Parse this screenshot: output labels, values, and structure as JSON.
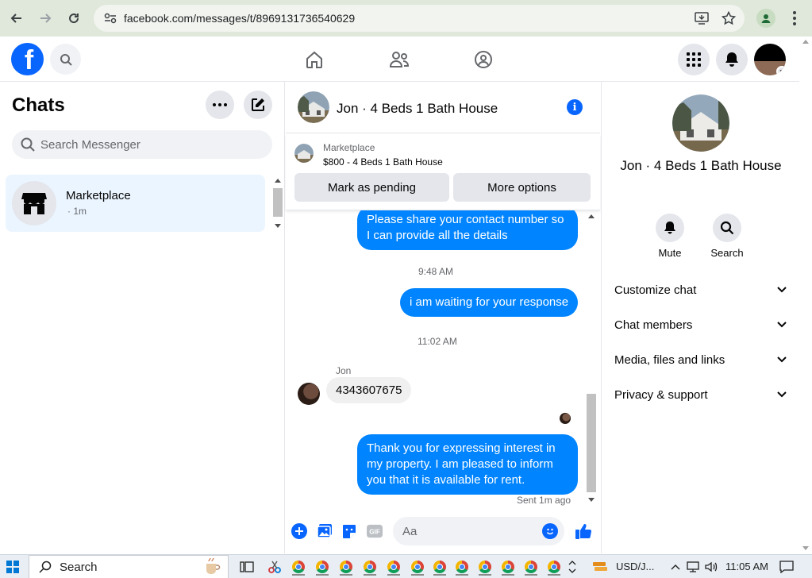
{
  "browser": {
    "url": "facebook.com/messages/t/8969131736540629"
  },
  "chats_panel": {
    "title": "Chats",
    "search_placeholder": "Search Messenger",
    "items": [
      {
        "name": "Marketplace",
        "subtitle": "· 1m"
      }
    ]
  },
  "conversation": {
    "title": "Jon · 4 Beds 1 Bath House",
    "marketplace_banner": {
      "label": "Marketplace",
      "listing": "$800 - 4 Beds 1 Bath House",
      "mark_pending": "Mark as pending",
      "more_options": "More options"
    },
    "messages": [
      {
        "from": "me",
        "text": "Please share your contact number so I can provide all the details"
      },
      {
        "type": "time",
        "text": "9:48 AM"
      },
      {
        "from": "me",
        "text": "i am waiting for your response"
      },
      {
        "type": "time",
        "text": "11:02 AM"
      },
      {
        "from": "them",
        "sender": "Jon",
        "text": "4343607675"
      },
      {
        "from": "me",
        "text": "Thank you for expressing interest in my property. I am pleased to inform you that it is available for rent."
      }
    ],
    "status": "Sent 1m ago",
    "composer_placeholder": "Aa"
  },
  "info_panel": {
    "name": "Jon · 4 Beds 1 Bath House",
    "actions": [
      {
        "label": "Mute",
        "icon": "bell-icon"
      },
      {
        "label": "Search",
        "icon": "search-icon"
      }
    ],
    "sections": [
      "Customize chat",
      "Chat members",
      "Media, files and links",
      "Privacy & support"
    ]
  },
  "taskbar": {
    "search_placeholder": "Search",
    "currency": "USD/J...",
    "clock": "11:05 AM"
  },
  "colors": {
    "brand": "#0866ff",
    "my_bubble": "#0084ff",
    "their_bubble": "#f0f0f0"
  }
}
